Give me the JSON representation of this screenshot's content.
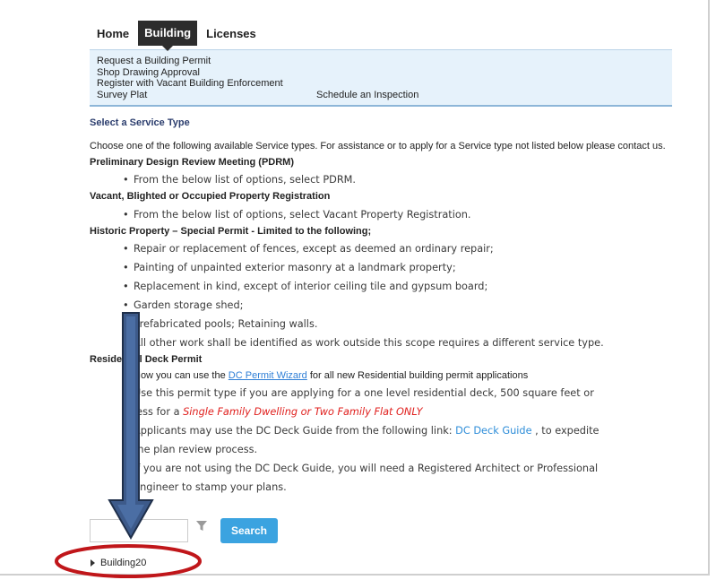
{
  "tabs": [
    {
      "label": "Home",
      "active": false
    },
    {
      "label": "Building",
      "active": true
    },
    {
      "label": "Licenses",
      "active": false
    }
  ],
  "submenu": {
    "items": [
      "Request a Building Permit",
      "Shop Drawing Approval",
      "Register with Vacant Building Enforcement"
    ],
    "last_row": [
      "Survey Plat",
      "Schedule an Inspection"
    ]
  },
  "section_title": "Select a Service Type",
  "intro": "Choose one of the following available Service types. For assistance or to apply for a Service type not listed below please contact us.",
  "groups": {
    "pdrm": {
      "heading": "Preliminary Design Review Meeting (PDRM)",
      "bullets": [
        "From the below list of options, select PDRM."
      ]
    },
    "vacant": {
      "heading": "Vacant, Blighted or Occupied Property Registration",
      "bullets": [
        "From the below list of options, select Vacant Property Registration."
      ]
    },
    "historic": {
      "heading": "Historic Property – Special Permit - Limited to the following;",
      "bullets": [
        "Repair or replacement of fences, except as deemed an ordinary repair;",
        "Painting of unpainted exterior masonry at a landmark property;",
        "Replacement in kind, except of interior ceiling tile and gypsum board;",
        "Garden storage shed;",
        "Prefabricated pools; Retaining walls.",
        "All other work shall be identified as work outside this scope requires a different service type."
      ]
    },
    "deck": {
      "heading": "Residential Deck Permit",
      "wizard_pre": "Now you can use the ",
      "wizard_link": "DC Permit Wizard",
      "wizard_post": " for all new Residential building permit applications",
      "b1_line1": "Use this permit type if you are applying for a one level residential deck, 500 square feet or",
      "b1_line2_pre": "less for a ",
      "b1_line2_red": "Single Family Dwelling or Two Family Flat ONLY",
      "b2_line1_pre": "Applicants may use the DC Deck Guide from the following link: ",
      "b2_link": "DC Deck Guide",
      "b2_line1_post": " , to expedite",
      "b2_line2": "the plan review process.",
      "b3_line1": "If you are not using the DC Deck Guide, you will need a Registered Architect or Professional",
      "b3_line2": "Engineer to stamp your plans."
    }
  },
  "search": {
    "placeholder": "",
    "value": "",
    "button_label": "Search"
  },
  "tree": {
    "item_label": "Building20"
  },
  "colors": {
    "arrow": "#3d5a8a",
    "ellipse": "#c0161a",
    "search_button": "#3ba3e0",
    "submenu_bg": "#e6f2fb"
  },
  "icons": {
    "filter": "filter-icon",
    "expand": "triangle-right-icon"
  }
}
